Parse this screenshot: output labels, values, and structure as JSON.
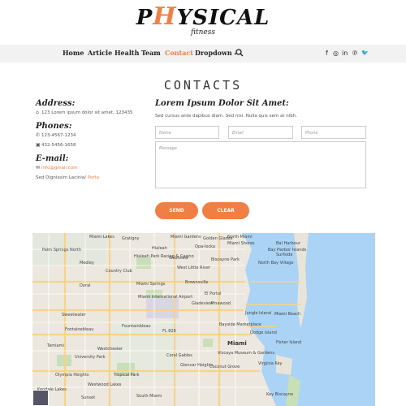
{
  "logo": {
    "first": "P",
    "accent": "H",
    "rest": "YSICAL",
    "sub": "fitness"
  },
  "nav": {
    "items": [
      "Home",
      "Article",
      "Health",
      "Team",
      "Contact",
      "Dropdown"
    ],
    "dropdown_caret": "▾",
    "active": "Contact",
    "social": [
      "f",
      "◎",
      "in",
      "℗",
      "🐦"
    ]
  },
  "title": "CONTACTS",
  "left": {
    "address_heading": "Address:",
    "address": "123 Lorem ipsum dolor sit amet, 123435",
    "phones_heading": "Phones:",
    "phone1": "123-4567-1234",
    "phone2": "432-5456-1658",
    "email_heading": "E-mail:",
    "email": "info@gmail.com",
    "extra_text": "Sed Dignissim Lacinia/",
    "extra_link": "Porta"
  },
  "form": {
    "title": "Lorem Ipsum Dolor Sit Amet:",
    "desc": "Sed cursus ante dapibus diam. Sed nisi. Nulla quis sem at nibh.",
    "name_placeholder": "Name",
    "email_placeholder": "Email",
    "phone_placeholder": "Phone",
    "message_placeholder": "Message",
    "send_label": "SEND",
    "clear_label": "CLEAR"
  },
  "map": {
    "labels": [
      "Hialeah",
      "Miami Gardens",
      "Opa-locka",
      "Miami Shores",
      "North Miami",
      "Miami Lakes",
      "Hialeah Park Racing & Casino",
      "Miami Springs",
      "Brownsville",
      "Miami International Airport",
      "Doral",
      "Sweetwater",
      "Westchester",
      "Coral Gables",
      "Tamiami",
      "University Park",
      "Olympia Heights",
      "Tropical Park",
      "Miami",
      "Bayside Marketplace",
      "Jungle Island",
      "Miami Beach",
      "Dodge Island",
      "Vizcaya Museum & Gardens",
      "Virginia Key",
      "Key Biscayne",
      "Coconut Grove",
      "Fisher Island",
      "South Miami",
      "Westwood Lakes",
      "North Bay Village",
      "Bal Harbour",
      "Surfside",
      "Bay Harbor Islands",
      "Biscayne Park",
      "El Portal",
      "West Little River",
      "Gladeview",
      "Pinewood",
      "Fontainebleau",
      "FL 826",
      "Glenvar Heights",
      "Sunset",
      "Kendale Lakes",
      "Fountainbleau",
      "Medley",
      "Palm Springs North",
      "Country Club",
      "Golden Glades",
      "Westview",
      "Gratigny"
    ]
  }
}
